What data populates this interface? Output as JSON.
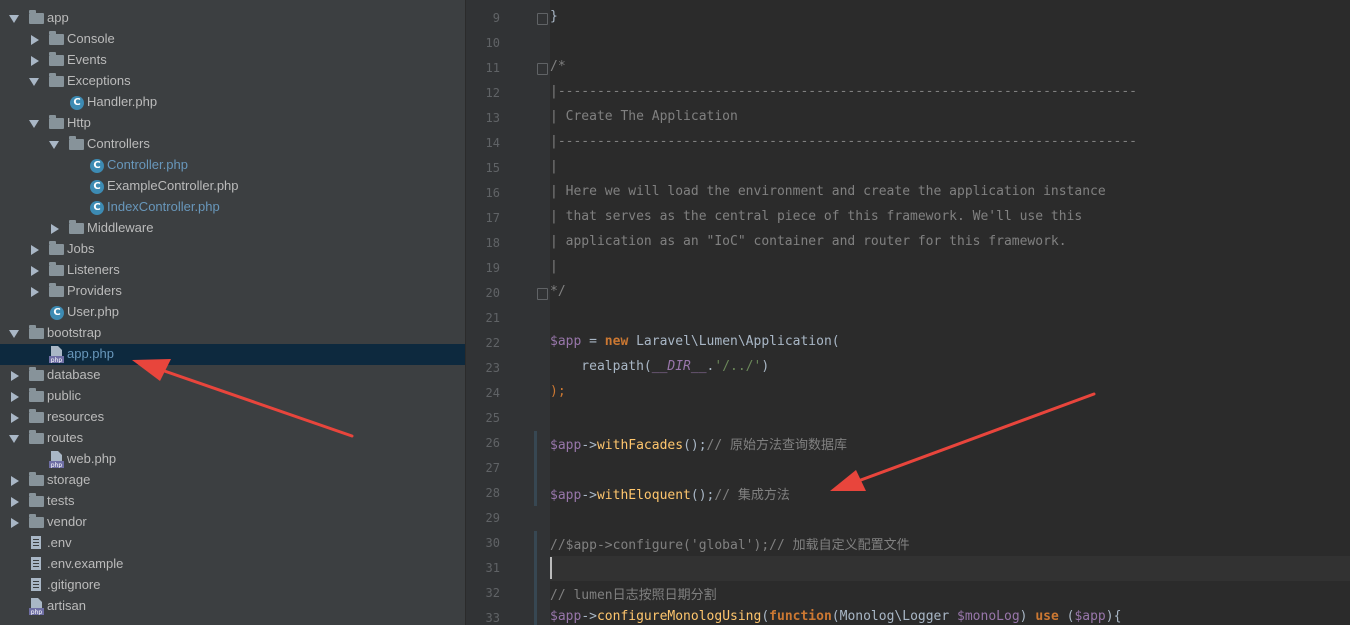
{
  "project_tree": {
    "items": [
      {
        "label": "app",
        "type": "folder",
        "depth": 0,
        "state": "open"
      },
      {
        "label": "Console",
        "type": "folder",
        "depth": 1,
        "state": "closed"
      },
      {
        "label": "Events",
        "type": "folder",
        "depth": 1,
        "state": "closed"
      },
      {
        "label": "Exceptions",
        "type": "folder",
        "depth": 1,
        "state": "open"
      },
      {
        "label": "Handler.php",
        "type": "class",
        "depth": 2
      },
      {
        "label": "Http",
        "type": "folder",
        "depth": 1,
        "state": "open"
      },
      {
        "label": "Controllers",
        "type": "folder",
        "depth": 2,
        "state": "open"
      },
      {
        "label": "Controller.php",
        "type": "class",
        "depth": 3,
        "style": "link"
      },
      {
        "label": "ExampleController.php",
        "type": "class",
        "depth": 3
      },
      {
        "label": "IndexController.php",
        "type": "class",
        "depth": 3,
        "style": "link"
      },
      {
        "label": "Middleware",
        "type": "folder",
        "depth": 2,
        "state": "closed"
      },
      {
        "label": "Jobs",
        "type": "folder",
        "depth": 1,
        "state": "closed"
      },
      {
        "label": "Listeners",
        "type": "folder",
        "depth": 1,
        "state": "closed"
      },
      {
        "label": "Providers",
        "type": "folder",
        "depth": 1,
        "state": "closed"
      },
      {
        "label": "User.php",
        "type": "class",
        "depth": 1
      },
      {
        "label": "bootstrap",
        "type": "folder",
        "depth": 0,
        "state": "open"
      },
      {
        "label": "app.php",
        "type": "phpfile",
        "depth": 1,
        "style": "link",
        "selected": true
      },
      {
        "label": "database",
        "type": "folder",
        "depth": 0,
        "state": "closed"
      },
      {
        "label": "public",
        "type": "folder",
        "depth": 0,
        "state": "closed"
      },
      {
        "label": "resources",
        "type": "folder",
        "depth": 0,
        "state": "closed"
      },
      {
        "label": "routes",
        "type": "folder",
        "depth": 0,
        "state": "open"
      },
      {
        "label": "web.php",
        "type": "phpfile",
        "depth": 1
      },
      {
        "label": "storage",
        "type": "folder",
        "depth": 0,
        "state": "closed"
      },
      {
        "label": "tests",
        "type": "folder",
        "depth": 0,
        "state": "closed"
      },
      {
        "label": "vendor",
        "type": "folder",
        "depth": 0,
        "state": "closed"
      },
      {
        "label": ".env",
        "type": "textfile",
        "depth": 0
      },
      {
        "label": ".env.example",
        "type": "textfile",
        "depth": 0
      },
      {
        "label": ".gitignore",
        "type": "textfile",
        "depth": 0
      },
      {
        "label": "artisan",
        "type": "phpfile",
        "depth": 0
      }
    ]
  },
  "editor": {
    "lines": [
      {
        "num": "9",
        "fold": true,
        "tokens": [
          {
            "t": "}",
            "c": "plain"
          }
        ]
      },
      {
        "num": "10",
        "tokens": []
      },
      {
        "num": "11",
        "fold": true,
        "tokens": [
          {
            "t": "/*",
            "c": "comment"
          }
        ]
      },
      {
        "num": "12",
        "tokens": [
          {
            "t": "|--------------------------------------------------------------------------",
            "c": "comment"
          }
        ]
      },
      {
        "num": "13",
        "tokens": [
          {
            "t": "| Create The Application",
            "c": "comment"
          }
        ]
      },
      {
        "num": "14",
        "tokens": [
          {
            "t": "|--------------------------------------------------------------------------",
            "c": "comment"
          }
        ]
      },
      {
        "num": "15",
        "tokens": [
          {
            "t": "|",
            "c": "comment"
          }
        ]
      },
      {
        "num": "16",
        "tokens": [
          {
            "t": "| Here we will load the environment and create the application instance",
            "c": "comment"
          }
        ]
      },
      {
        "num": "17",
        "tokens": [
          {
            "t": "| that serves as the central piece of this framework. We'll use this",
            "c": "comment"
          }
        ]
      },
      {
        "num": "18",
        "tokens": [
          {
            "t": "| application as an \"IoC\" container and router for this framework.",
            "c": "comment"
          }
        ]
      },
      {
        "num": "19",
        "tokens": [
          {
            "t": "|",
            "c": "comment"
          }
        ]
      },
      {
        "num": "20",
        "fold": true,
        "tokens": [
          {
            "t": "*/",
            "c": "comment"
          }
        ]
      },
      {
        "num": "21",
        "tokens": []
      },
      {
        "num": "22",
        "tokens": [
          {
            "t": "$app",
            "c": "var"
          },
          {
            "t": " = ",
            "c": "plain"
          },
          {
            "t": "new",
            "c": "kw"
          },
          {
            "t": " Laravel\\Lumen\\Application(",
            "c": "plain"
          }
        ]
      },
      {
        "num": "23",
        "tokens": [
          {
            "t": "    realpath(",
            "c": "plain"
          },
          {
            "t": "__DIR__",
            "c": "const"
          },
          {
            "t": ".",
            "c": "plain"
          },
          {
            "t": "'/../'",
            "c": "str"
          },
          {
            "t": ")",
            "c": "plain"
          }
        ]
      },
      {
        "num": "24",
        "tokens": [
          {
            "t": ");",
            "c": "punc"
          }
        ]
      },
      {
        "num": "25",
        "tokens": []
      },
      {
        "num": "26",
        "change": true,
        "tokens": [
          {
            "t": "$app",
            "c": "var"
          },
          {
            "t": "->",
            "c": "plain"
          },
          {
            "t": "withFacades",
            "c": "fn"
          },
          {
            "t": "();",
            "c": "plain"
          },
          {
            "t": "// ",
            "c": "comment"
          },
          {
            "t": "原始方法查询数据库",
            "c": "comment",
            "cn": true
          }
        ]
      },
      {
        "num": "27",
        "change": true,
        "tokens": []
      },
      {
        "num": "28",
        "change": true,
        "tokens": [
          {
            "t": "$app",
            "c": "var"
          },
          {
            "t": "->",
            "c": "plain"
          },
          {
            "t": "withEloquent",
            "c": "fn"
          },
          {
            "t": "();",
            "c": "plain"
          },
          {
            "t": "// ",
            "c": "comment"
          },
          {
            "t": "集成方法",
            "c": "comment",
            "cn": true
          }
        ]
      },
      {
        "num": "29",
        "tokens": []
      },
      {
        "num": "30",
        "change": true,
        "tokens": [
          {
            "t": "//$app->configure('global');// ",
            "c": "comment"
          },
          {
            "t": "加载自定义配置文件",
            "c": "comment",
            "cn": true
          }
        ]
      },
      {
        "num": "31",
        "change": true,
        "caret": true,
        "tokens": []
      },
      {
        "num": "32",
        "change": true,
        "tokens": [
          {
            "t": "// lumen",
            "c": "comment"
          },
          {
            "t": "日志按照日期分割",
            "c": "comment",
            "cn": true
          }
        ]
      },
      {
        "num": "33",
        "change": true,
        "tokens": [
          {
            "t": "$app",
            "c": "var"
          },
          {
            "t": "->",
            "c": "plain"
          },
          {
            "t": "configureMonologUsing",
            "c": "fn"
          },
          {
            "t": "(",
            "c": "plain"
          },
          {
            "t": "function",
            "c": "kw"
          },
          {
            "t": "(Monolog\\Logger ",
            "c": "plain"
          },
          {
            "t": "$monoLog",
            "c": "var"
          },
          {
            "t": ") ",
            "c": "plain"
          },
          {
            "t": "use",
            "c": "kw"
          },
          {
            "t": " (",
            "c": "plain"
          },
          {
            "t": "$app",
            "c": "var"
          },
          {
            "t": "){",
            "c": "plain"
          }
        ]
      }
    ]
  },
  "colors": {
    "annotation_arrow": "#e8453c",
    "selection": "#0d293e",
    "sidebar_bg": "#3c3f41",
    "editor_bg": "#2b2b2b"
  }
}
